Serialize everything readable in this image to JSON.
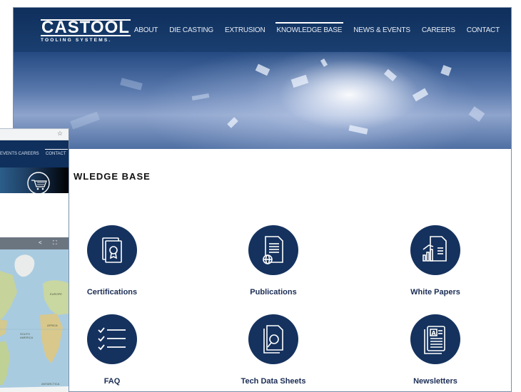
{
  "main": {
    "logo": {
      "name": "CASTOOL",
      "tagline": "TOOLING SYSTEMS."
    },
    "nav": [
      {
        "label": "ABOUT",
        "active": false
      },
      {
        "label": "DIE CASTING",
        "active": false
      },
      {
        "label": "EXTRUSION",
        "active": false
      },
      {
        "label": "KNOWLEDGE BASE",
        "active": true
      },
      {
        "label": "NEWS & EVENTS",
        "active": false
      },
      {
        "label": "CAREERS",
        "active": false
      },
      {
        "label": "CONTACT",
        "active": false
      }
    ],
    "heading": "WLEDGE BASE",
    "tiles": [
      {
        "label": "Certifications",
        "icon": "certificate-icon"
      },
      {
        "label": "Publications",
        "icon": "publication-globe-icon"
      },
      {
        "label": "White Papers",
        "icon": "chart-document-icon"
      },
      {
        "label": "FAQ",
        "icon": "checklist-icon"
      },
      {
        "label": "Tech Data Sheets",
        "icon": "magnifier-document-icon"
      },
      {
        "label": "Newsletters",
        "icon": "newsletter-icon"
      }
    ]
  },
  "background_window": {
    "star": "☆",
    "nav_partial": "EVENTS   CAREERS",
    "nav_contact": "CONTACT",
    "map_toolbar": {
      "share": "<",
      "expand": "⛶"
    },
    "map_labels": [
      "EUROPE",
      "AFRICA",
      "SOUTH AMERICA",
      "ANTARCTICA"
    ]
  },
  "colors": {
    "header": "#0f2f5c",
    "tile_circle": "#15325e",
    "tile_label": "#1b2d55",
    "window_border": "#7a8fa8"
  }
}
